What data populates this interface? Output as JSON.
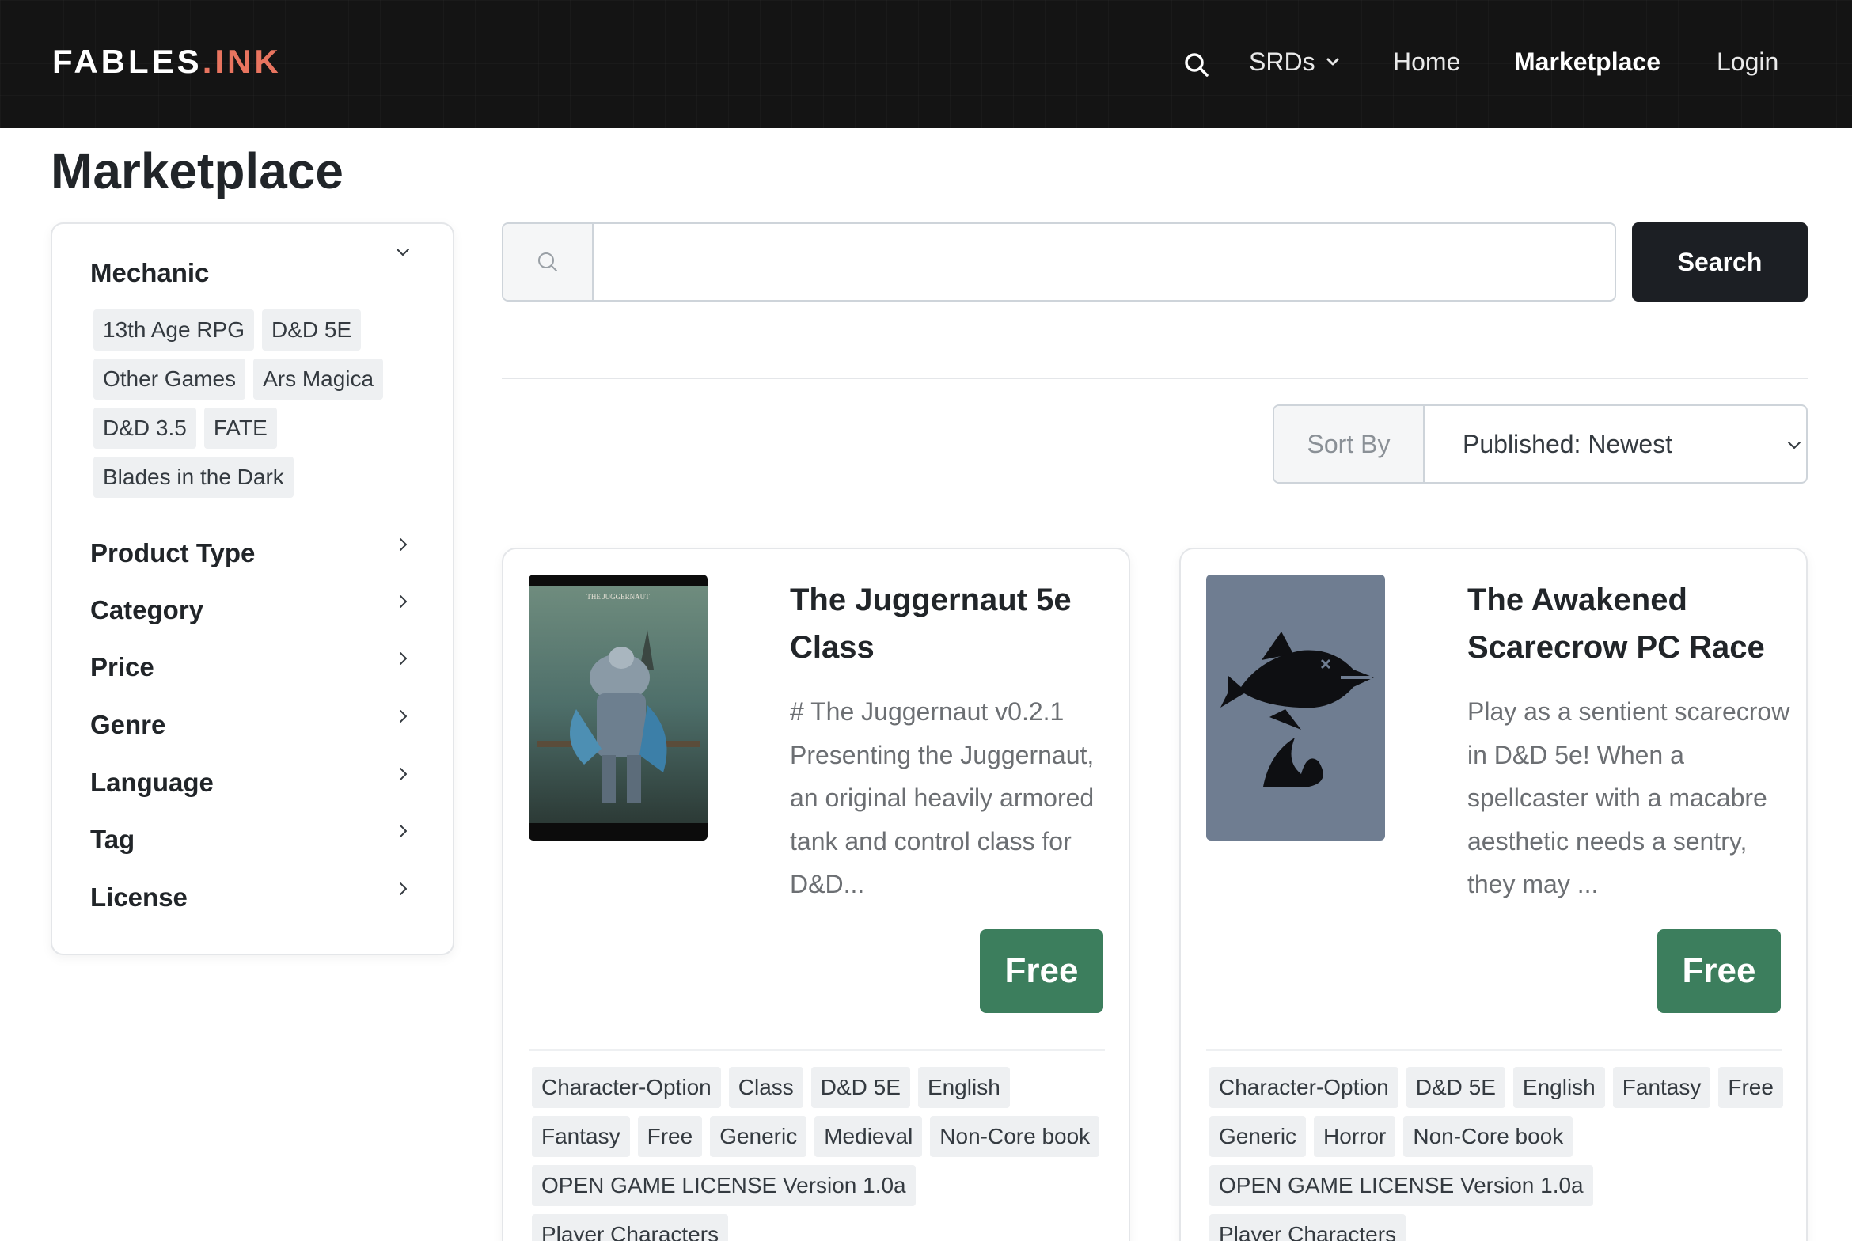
{
  "header": {
    "brand_main": "FABLES",
    "brand_accent": ".INK",
    "nav": {
      "srds": "SRDs",
      "home": "Home",
      "marketplace": "Marketplace",
      "login": "Login"
    },
    "icons": {
      "search": "search-icon",
      "dropdown": "chevron-down-icon"
    }
  },
  "page": {
    "title": "Marketplace"
  },
  "sidebar": {
    "mechanic": {
      "label": "Mechanic",
      "chips": [
        "13th Age RPG",
        "D&D 5E",
        "Other Games",
        "Ars Magica",
        "D&D 3.5",
        "FATE",
        "Blades in the Dark"
      ]
    },
    "facets": [
      "Product Type",
      "Category",
      "Price",
      "Genre",
      "Language",
      "Tag",
      "License"
    ]
  },
  "search": {
    "value": "",
    "button_label": "Search"
  },
  "sort": {
    "label": "Sort By",
    "selected": "Published: Newest"
  },
  "products": [
    {
      "title": "The Juggernaut 5e Class",
      "description": "# The Juggernaut v0.2.1 Presenting the Juggernaut, an original heavily armored tank and control class for D&D...",
      "price": "Free",
      "cover_text": "THE JUGGERNAUT",
      "tags": [
        "Character-Option",
        "Class",
        "D&D 5E",
        "English",
        "Fantasy",
        "Free",
        "Generic",
        "Medieval",
        "Non-Core book",
        "OPEN GAME LICENSE Version 1.0a",
        "Player Characters"
      ]
    },
    {
      "title": "The Awakened Scarecrow PC Race",
      "description": "Play as a sentient scarecrow in D&D 5e! When a spellcaster with a macabre aesthetic needs a sentry, they may ...",
      "price": "Free",
      "tags": [
        "Character-Option",
        "D&D 5E",
        "English",
        "Fantasy",
        "Free",
        "Generic",
        "Horror",
        "Non-Core book",
        "OPEN GAME LICENSE Version 1.0a",
        "Player Characters"
      ]
    }
  ],
  "colors": {
    "navbar": "#141414",
    "brand_accent": "#e8745f",
    "price_button": "#3c7e5d",
    "search_button": "#1c1f24",
    "chip_bg": "#eef0f2"
  }
}
